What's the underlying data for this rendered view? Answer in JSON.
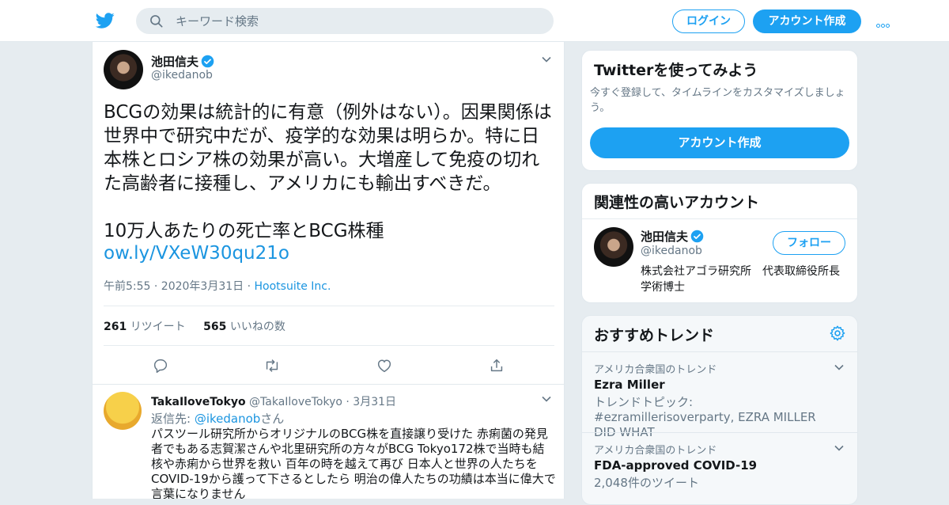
{
  "header": {
    "search_placeholder": "キーワード検索",
    "login_label": "ログイン",
    "signup_label": "アカウント作成"
  },
  "tweet": {
    "display_name": "池田信夫",
    "handle": "@ikedanob",
    "text": "BCGの効果は統計的に有意（例外はない）。因果関係は世界中で研究中だが、疫学的な効果は明らか。特に日本株とロシア株の効果が高い。大増産して免疫の切れた高齢者に接種し、アメリカにも輸出すべきだ。\n\n10万人あたりの死亡率とBCG株種",
    "link": "ow.ly/VXeW30qu21o",
    "time": "午前5:55 · 2020年3月31日 ·",
    "source": "Hootsuite Inc.",
    "retweets_count": "261",
    "retweets_label": "リツイート",
    "likes_count": "565",
    "likes_label": "いいねの数"
  },
  "reply": {
    "display_name": "TakaIloveTokyo",
    "handle_date": "@TakaIloveTokyo · 3月31日",
    "to_prefix": "返信先: ",
    "to_mention": "@ikedanob",
    "to_suffix": "さん",
    "text": "パスツール研究所からオリジナルのBCG株を直接譲り受けた 赤痢菌の発見者でもある志賀潔さんや北里研究所の方々がBCG Tokyo172株で当時も結核や赤痢から世界を救い 百年の時を越えて再び 日本人と世界の人たちをCOVID-19から護って下さるとしたら 明治の偉人たちの功績は本当に偉大で言葉になりません"
  },
  "signup_card": {
    "title": "Twitterを使ってみよう",
    "description": "今すぐ登録して、タイムラインをカスタマイズしましょう。",
    "button": "アカウント作成"
  },
  "related_card": {
    "title": "関連性の高いアカウント",
    "name": "池田信夫",
    "handle": "@ikedanob",
    "follow": "フォロー",
    "bio": "株式会社アゴラ研究所　代表取締役所長　学術博士"
  },
  "trends_card": {
    "title": "おすすめトレンド",
    "items": [
      {
        "context": "アメリカ合衆国のトレンド",
        "name": "Ezra Miller",
        "meta": "トレンドトピック: #ezramillerisoverparty, EZRA MILLER DID WHAT"
      },
      {
        "context": "アメリカ合衆国のトレンド",
        "name": "FDA-approved COVID-19",
        "meta": "2,048件のツイート"
      }
    ]
  },
  "colors": {
    "accent": "#1da1f2",
    "link": "#1b95e0",
    "background": "#e6ecf0"
  }
}
